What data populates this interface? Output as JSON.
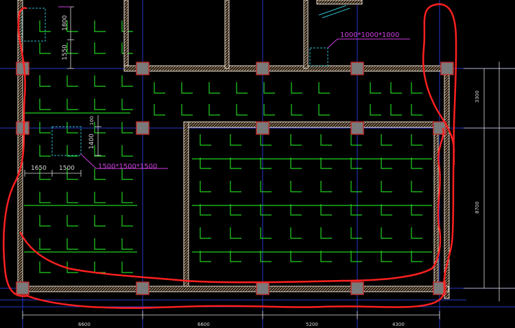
{
  "colors": {
    "background": "#000000",
    "grid_axis": "#2838c8",
    "rebar": "#21d321",
    "wall_outline": "#e8dccb",
    "wall_hatch": "#b89a78",
    "column_fill": "#7a7a7a",
    "column_stroke": "#c03030",
    "red_markup": "#ff2020",
    "magenta": "#d040e0",
    "cyan": "#30c0d0",
    "dimension": "#d8d8d8"
  },
  "annotations": {
    "pit_left": "1500*1500*1500",
    "pit_right": "1000*1000*1000"
  },
  "dimensions": {
    "left_top_vertical_a": "1800",
    "left_top_vertical_b": "1550",
    "pit_left_vertical_a": "100",
    "pit_left_vertical_b": "1400",
    "pit_left_horizontal_a": "1650",
    "pit_left_horizontal_b": "1500",
    "right_vertical_a": "3300",
    "right_vertical_b": "8700",
    "bottom_bays": [
      "6600",
      "6600",
      "5200",
      "4300"
    ]
  }
}
